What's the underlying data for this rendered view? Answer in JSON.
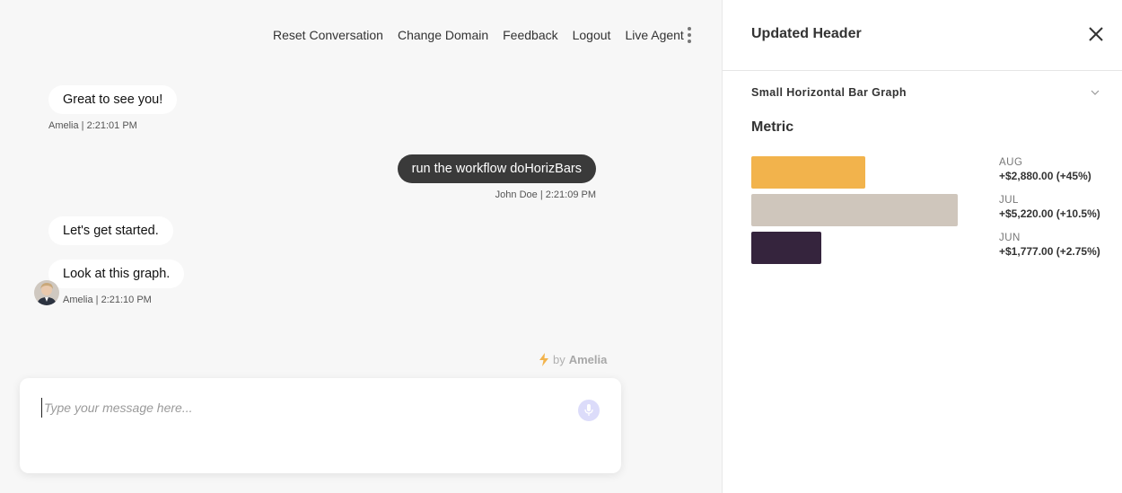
{
  "nav": {
    "items": [
      "Reset Conversation",
      "Change Domain",
      "Feedback",
      "Logout",
      "Live Agent"
    ]
  },
  "messages": [
    {
      "text": "Great to see you!",
      "meta": "Amelia | 2:21:01 PM"
    },
    {
      "text": "run the workflow doHorizBars",
      "meta": "John Doe | 2:21:09 PM"
    },
    {
      "text": "Let's get started."
    },
    {
      "text": "Look at this graph.",
      "meta": "Amelia | 2:21:10 PM"
    }
  ],
  "powered_by": {
    "by": "by",
    "brand": "Amelia"
  },
  "composer": {
    "placeholder": "Type your message here..."
  },
  "panel": {
    "title": "Updated Header",
    "section_title": "Small Horizontal Bar Graph",
    "metric_title": "Metric"
  },
  "colors": {
    "aug": "#f2b34c",
    "jul": "#cfc6bc",
    "jun": "#35243d",
    "user_bubble": "#3a3a3a",
    "mic": "#dcdcfa"
  },
  "chart_data": {
    "type": "bar",
    "orientation": "horizontal",
    "title": "Metric",
    "categories": [
      "AUG",
      "JUL",
      "JUN"
    ],
    "values": [
      2880,
      5220,
      1777
    ],
    "value_labels": [
      "+$2,880.00 (+45%)",
      "+$5,220.00 (+10.5%)",
      "+$1,777.00 (+2.75%)"
    ],
    "colors": [
      "#f2b34c",
      "#cfc6bc",
      "#35243d"
    ],
    "xlim": [
      0,
      5220
    ]
  }
}
